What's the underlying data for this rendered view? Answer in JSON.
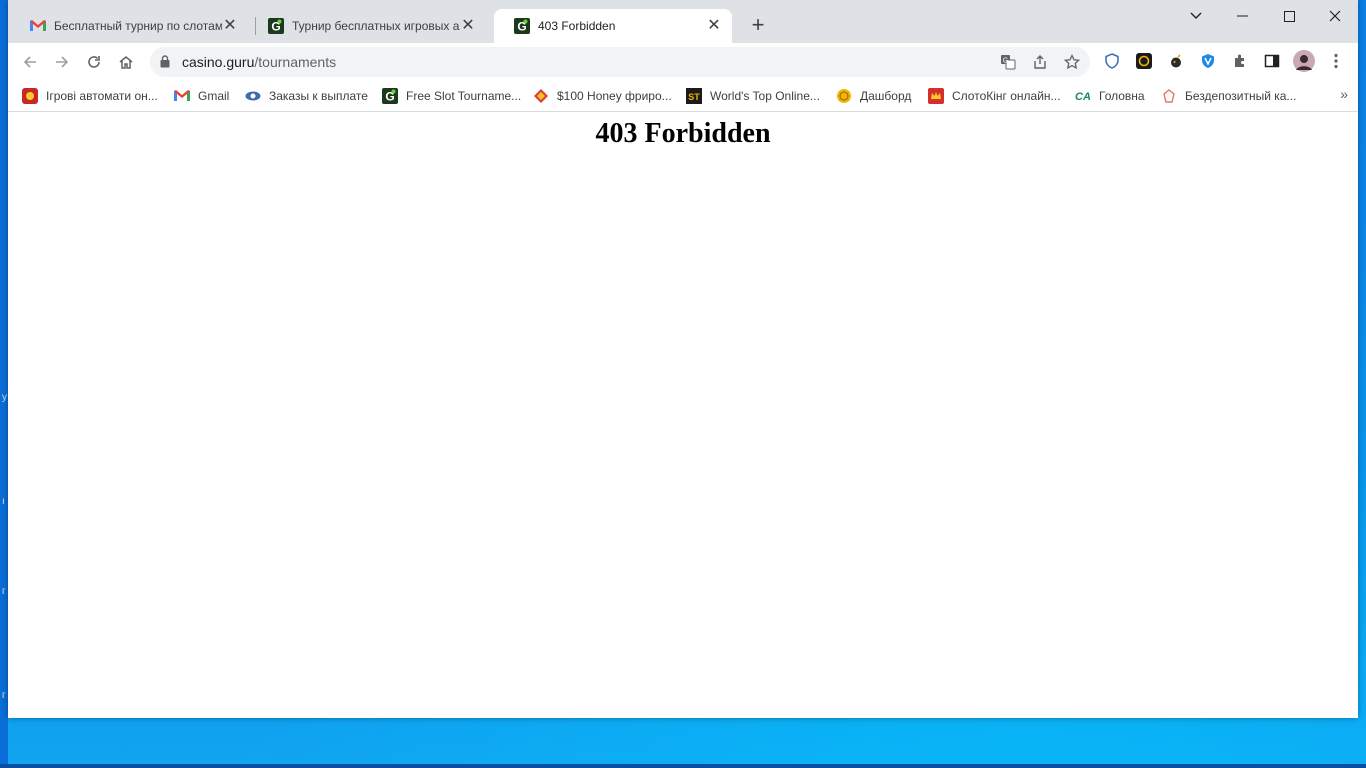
{
  "browser": {
    "tabs": [
      {
        "title": "Бесплатный турнир по слотам с",
        "favicon": "gmail-icon"
      },
      {
        "title": "Турнир бесплатных игровых ав",
        "favicon": "casino-guru-icon"
      },
      {
        "title": "403 Forbidden",
        "favicon": "casino-guru-icon",
        "active": true
      }
    ],
    "address": {
      "host": "casino.guru",
      "path": "/tournaments"
    },
    "bookmarks": [
      {
        "label": "Ігрові автомати он...",
        "icon": "slot-icon",
        "color": "#c62828"
      },
      {
        "label": "Gmail",
        "icon": "gmail-icon",
        "color": "#ea4335"
      },
      {
        "label": "Заказы к выплате",
        "icon": "eye-icon",
        "color": "#3b6db3"
      },
      {
        "label": "Free Slot Tourname...",
        "icon": "casino-guru-icon",
        "color": "#2e7d32"
      },
      {
        "label": "$100 Honey фриро...",
        "icon": "diamond-icon",
        "color": "#e53935"
      },
      {
        "label": "World's Top Online...",
        "icon": "st-icon",
        "color": "#1b1b1b"
      },
      {
        "label": "Дашборд",
        "icon": "coin-icon",
        "color": "#f2b705"
      },
      {
        "label": "СлотоКінг онлайн...",
        "icon": "crown-icon",
        "color": "#d32f2f"
      },
      {
        "label": "Головна",
        "icon": "ca-icon",
        "color": "#1a8a5a"
      },
      {
        "label": "Бездепозитный ка...",
        "icon": "cards-icon",
        "color": "#e57373"
      }
    ]
  },
  "page": {
    "heading": "403 Forbidden"
  }
}
